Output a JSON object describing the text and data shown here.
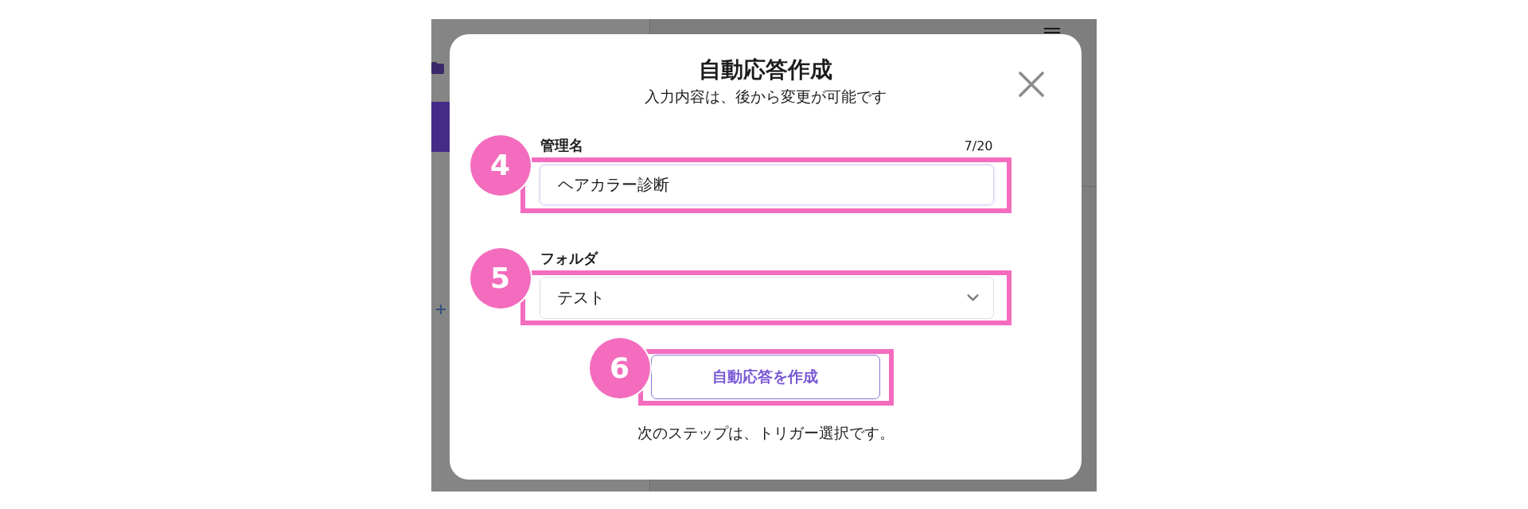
{
  "dialog": {
    "title": "自動応答作成",
    "subtitle": "入力内容は、後から変更が可能です"
  },
  "fields": [
    {
      "kind": "text",
      "label": "管理名",
      "counter": "7/20",
      "value": "ヘアカラー診断",
      "callout": "4"
    },
    {
      "kind": "select",
      "label": "フォルダ",
      "value": "テスト",
      "callout": "5"
    }
  ],
  "submit_button": {
    "label": "自動応答を作成",
    "callout": "6"
  },
  "footnote": "次のステップは、トリガー選択です。"
}
